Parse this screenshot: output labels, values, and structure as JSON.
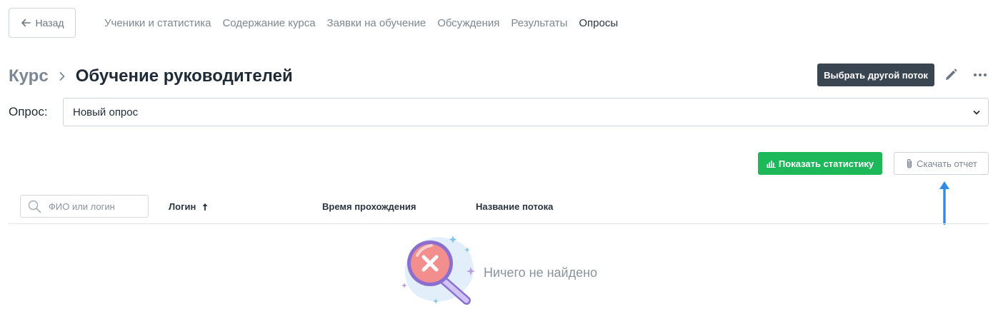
{
  "nav": {
    "back_label": "Назад",
    "links": [
      {
        "label": "Ученики и статистика",
        "active": false
      },
      {
        "label": "Содержание курса",
        "active": false
      },
      {
        "label": "Заявки на обучение",
        "active": false
      },
      {
        "label": "Обсуждения",
        "active": false
      },
      {
        "label": "Результаты",
        "active": false
      },
      {
        "label": "Опросы",
        "active": true
      }
    ]
  },
  "breadcrumb": {
    "parent": "Курс",
    "current": "Обучение руководителей"
  },
  "header_actions": {
    "choose_stream_label": "Выбрать другой поток",
    "edit_icon": "pencil-icon",
    "more_icon": "more-horizontal-icon"
  },
  "survey": {
    "label": "Опрос:",
    "selected": "Новый опрос"
  },
  "actions": {
    "show_stats_label": "Показать статистику",
    "download_report_label": "Скачать отчет"
  },
  "table": {
    "search_placeholder": "ФИО или логин",
    "search_value": "",
    "columns": {
      "login": "Логин",
      "time": "Время прохождения",
      "stream": "Название потока"
    },
    "sort": {
      "column": "login",
      "direction": "asc"
    }
  },
  "empty_state": {
    "text": "Ничего не найдено"
  },
  "colors": {
    "primary_dark": "#3a4552",
    "success": "#1cb85a",
    "annotation_arrow": "#2f8be6",
    "muted_text": "#7d8791"
  }
}
